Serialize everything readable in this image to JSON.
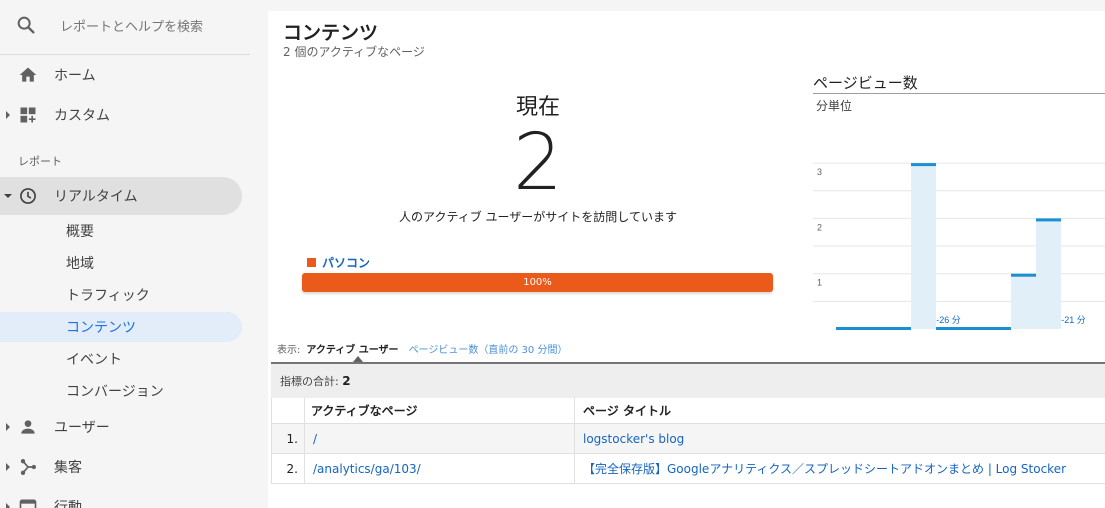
{
  "sidebar": {
    "search_placeholder": "レポートとヘルプを検索",
    "home": "ホーム",
    "custom": "カスタム",
    "section_reports": "レポート",
    "realtime": "リアルタイム",
    "realtime_items": [
      "概要",
      "地域",
      "トラフィック",
      "コンテンツ",
      "イベント",
      "コンバージョン"
    ],
    "users": "ユーザー",
    "acquisition": "集客",
    "behavior": "行動"
  },
  "page": {
    "title": "コンテンツ",
    "subtitle": "2 個のアクティブなページ"
  },
  "now": {
    "label": "現在",
    "value": "2",
    "description": "人のアクティブ ユーザーがサイトを訪問しています",
    "device_label": "パソコン",
    "device_percent": "100%",
    "device_color": "#ea5a1a"
  },
  "pageviews": {
    "title": "ページビュー数",
    "unit": "分単位"
  },
  "chart_data": {
    "type": "bar",
    "title": "ページビュー数",
    "subtitle": "分単位",
    "ylim": [
      0,
      3.4
    ],
    "yticks": [
      "1",
      "2",
      "3"
    ],
    "xlabels": [
      "-26 分",
      "-21 分"
    ],
    "bars": [
      {
        "minute": -30,
        "value": 0
      },
      {
        "minute": -29,
        "value": 0
      },
      {
        "minute": -28,
        "value": 0
      },
      {
        "minute": -27,
        "value": 3
      },
      {
        "minute": -26,
        "value": 0
      },
      {
        "minute": -25,
        "value": 0
      },
      {
        "minute": -24,
        "value": 0
      },
      {
        "minute": -23,
        "value": 1
      },
      {
        "minute": -22,
        "value": 2
      }
    ],
    "color": "#1a8fd1"
  },
  "view": {
    "label": "表示:",
    "active_tab": "アクティブ ユーザー",
    "other_tab": "ページビュー数（直前の 30 分間）"
  },
  "metric": {
    "label": "指標の合計:",
    "value": "2"
  },
  "table": {
    "headers": [
      "アクティブなページ",
      "ページ タイトル"
    ],
    "rows": [
      {
        "num": "1.",
        "page": "/",
        "title": "logstocker's blog"
      },
      {
        "num": "2.",
        "page": "/analytics/ga/103/",
        "title": "【完全保存版】Googleアナリティクス／スプレッドシートアドオンまとめ | Log Stocker"
      }
    ]
  }
}
